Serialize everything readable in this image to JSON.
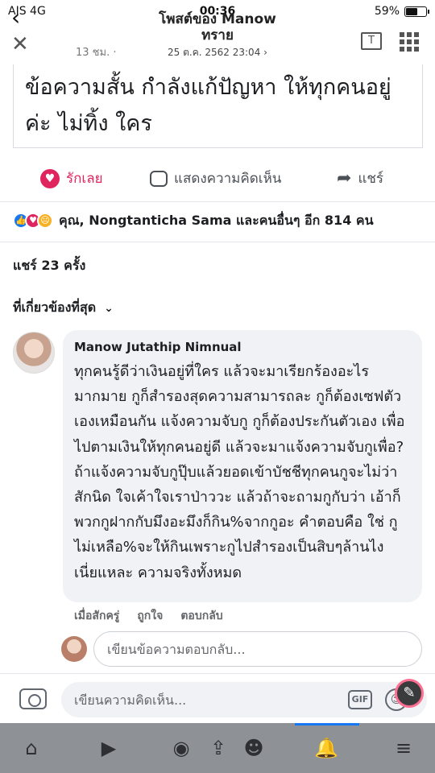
{
  "status_bar": {
    "carrier": "AIS  4G",
    "time": "00:36",
    "battery": "59%",
    "battery_level": 0.59
  },
  "header": {
    "title_line1": "โพสต์ของ Manow",
    "title_line2": "ทราย",
    "subtitle": "25 ต.ค. 2562 23:04 ›",
    "time_ago": "13 ชม. ·",
    "translate_icon": "translate-icon",
    "translate_label": "T"
  },
  "post": {
    "text": "ข้อความสั้น กำลังแก้ปัญหา ให้ทุกคนอยู่ค่ะ ไม่ทิ้ง ใคร"
  },
  "actions": {
    "like_label": "รักเลย",
    "comment_label": "แสดงความคิดเห็น",
    "share_label": "แชร์"
  },
  "reactions": {
    "summary": "คุณ, Nongtanticha Sama และคนอื่นๆ อีก 814 คน"
  },
  "shares": "แชร์ 23 ครั้ง",
  "sort": {
    "label": "ที่เกี่ยวข้องที่สุด"
  },
  "comment": {
    "author": "Manow Jutathip Nimnual",
    "body": "ทุกคนรู้ดีว่าเงินอยู่ที่ใคร แล้วจะมาเรียกร้องอะไรมากมาย กูก็สำรองสุดความสามารถละ กูก็ต้องเซฟตัวเองเหมือนกัน แจ้งความจับกู กูก็ต้องประกันตัวเอง เพื่อไปตามเงินให้ทุกคนอยู่ดี แล้วจะมาแจ้งความจับกูเพื่อ? ถ้าแจ้งความจับกูปุ๊บแล้วยอดเข้าบัชชีทุกคนกูจะไม่ว่าสักนิด ใจเค้าใจเราป่าววะ แล้วถ้าจะถามกูกับว่า เอ้าก็พวกกูฝากกับมึงอะมึงก็กิน%จากกูอะ คำตอบคือ ใช่ กูไม่เหลือ%จะให้กินเพราะกูไปสำรองเป็นสิบๆล้านไง เนี่ยแหละ ความจริงทั้งหมด",
    "time": "เมื่อสักครู่",
    "like": "ถูกใจ",
    "reply": "ตอบกลับ"
  },
  "reply_box": {
    "placeholder": "เขียนข้อความตอบกลับ..."
  },
  "composer": {
    "placeholder": "เขียนความคิดเห็น...",
    "gif_label": "GIF"
  },
  "nav": {
    "active": "notifications"
  }
}
